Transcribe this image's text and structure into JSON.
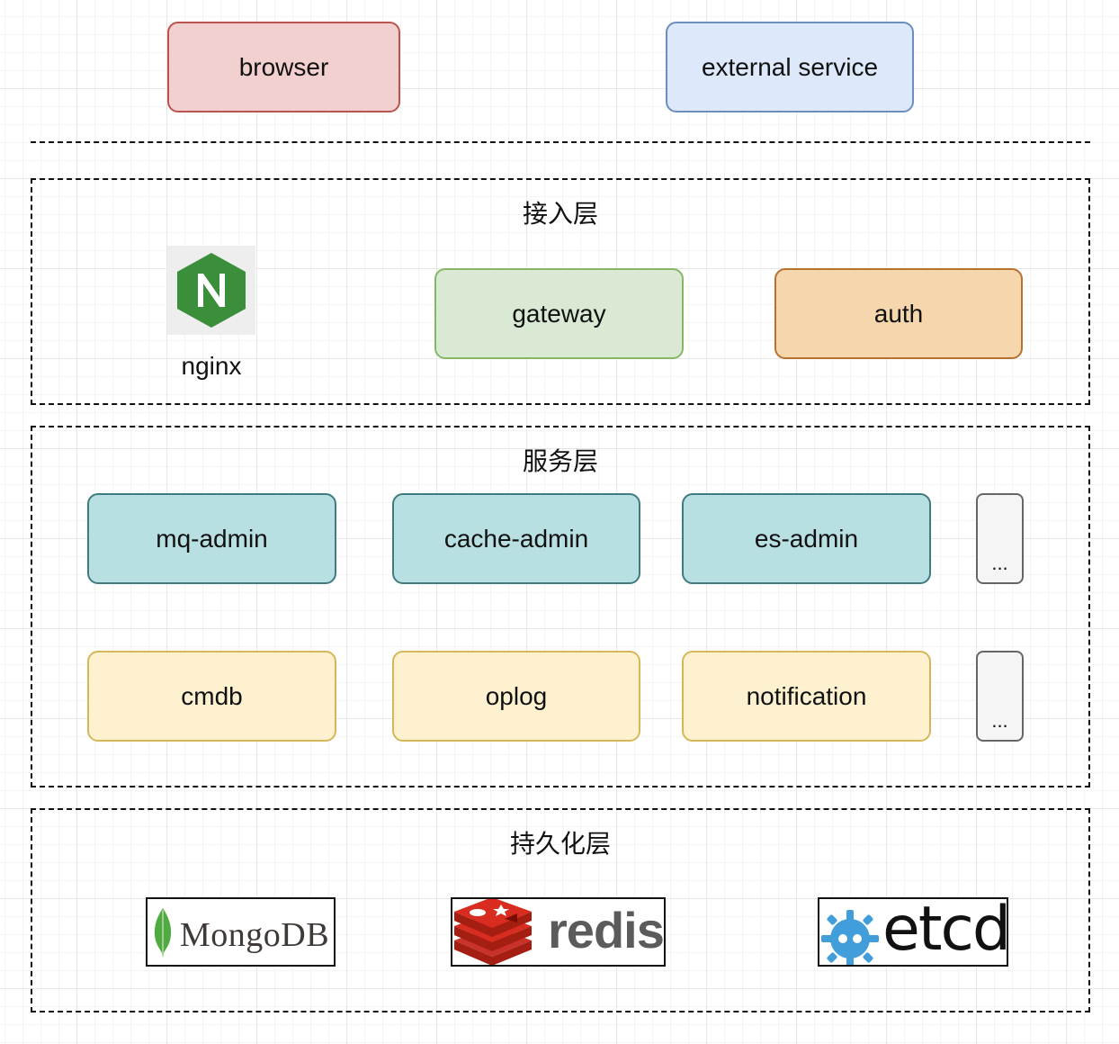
{
  "clients": {
    "browser": "browser",
    "external_service": "external service"
  },
  "access_layer": {
    "title": "接入层",
    "nginx_label": "nginx",
    "gateway": "gateway",
    "auth": "auth"
  },
  "service_layer": {
    "title": "服务层",
    "row1": [
      "mq-admin",
      "cache-admin",
      "es-admin",
      "..."
    ],
    "row2": [
      "cmdb",
      "oplog",
      "notification",
      "..."
    ]
  },
  "persistence_layer": {
    "title": "持久化层",
    "mongodb": "MongoDB",
    "redis": "redis",
    "etcd": "etcd"
  },
  "colors": {
    "browser_fill": "#f2d0cf",
    "external_fill": "#dde8fa",
    "gateway_fill": "#d9e9d4",
    "auth_fill": "#f6d6ad",
    "admin_fill": "#b8e0e2",
    "core_fill": "#fdf1cf",
    "nginx_green": "#3b8f3b",
    "redis_red": "#c8322a",
    "etcd_blue": "#419eda"
  }
}
